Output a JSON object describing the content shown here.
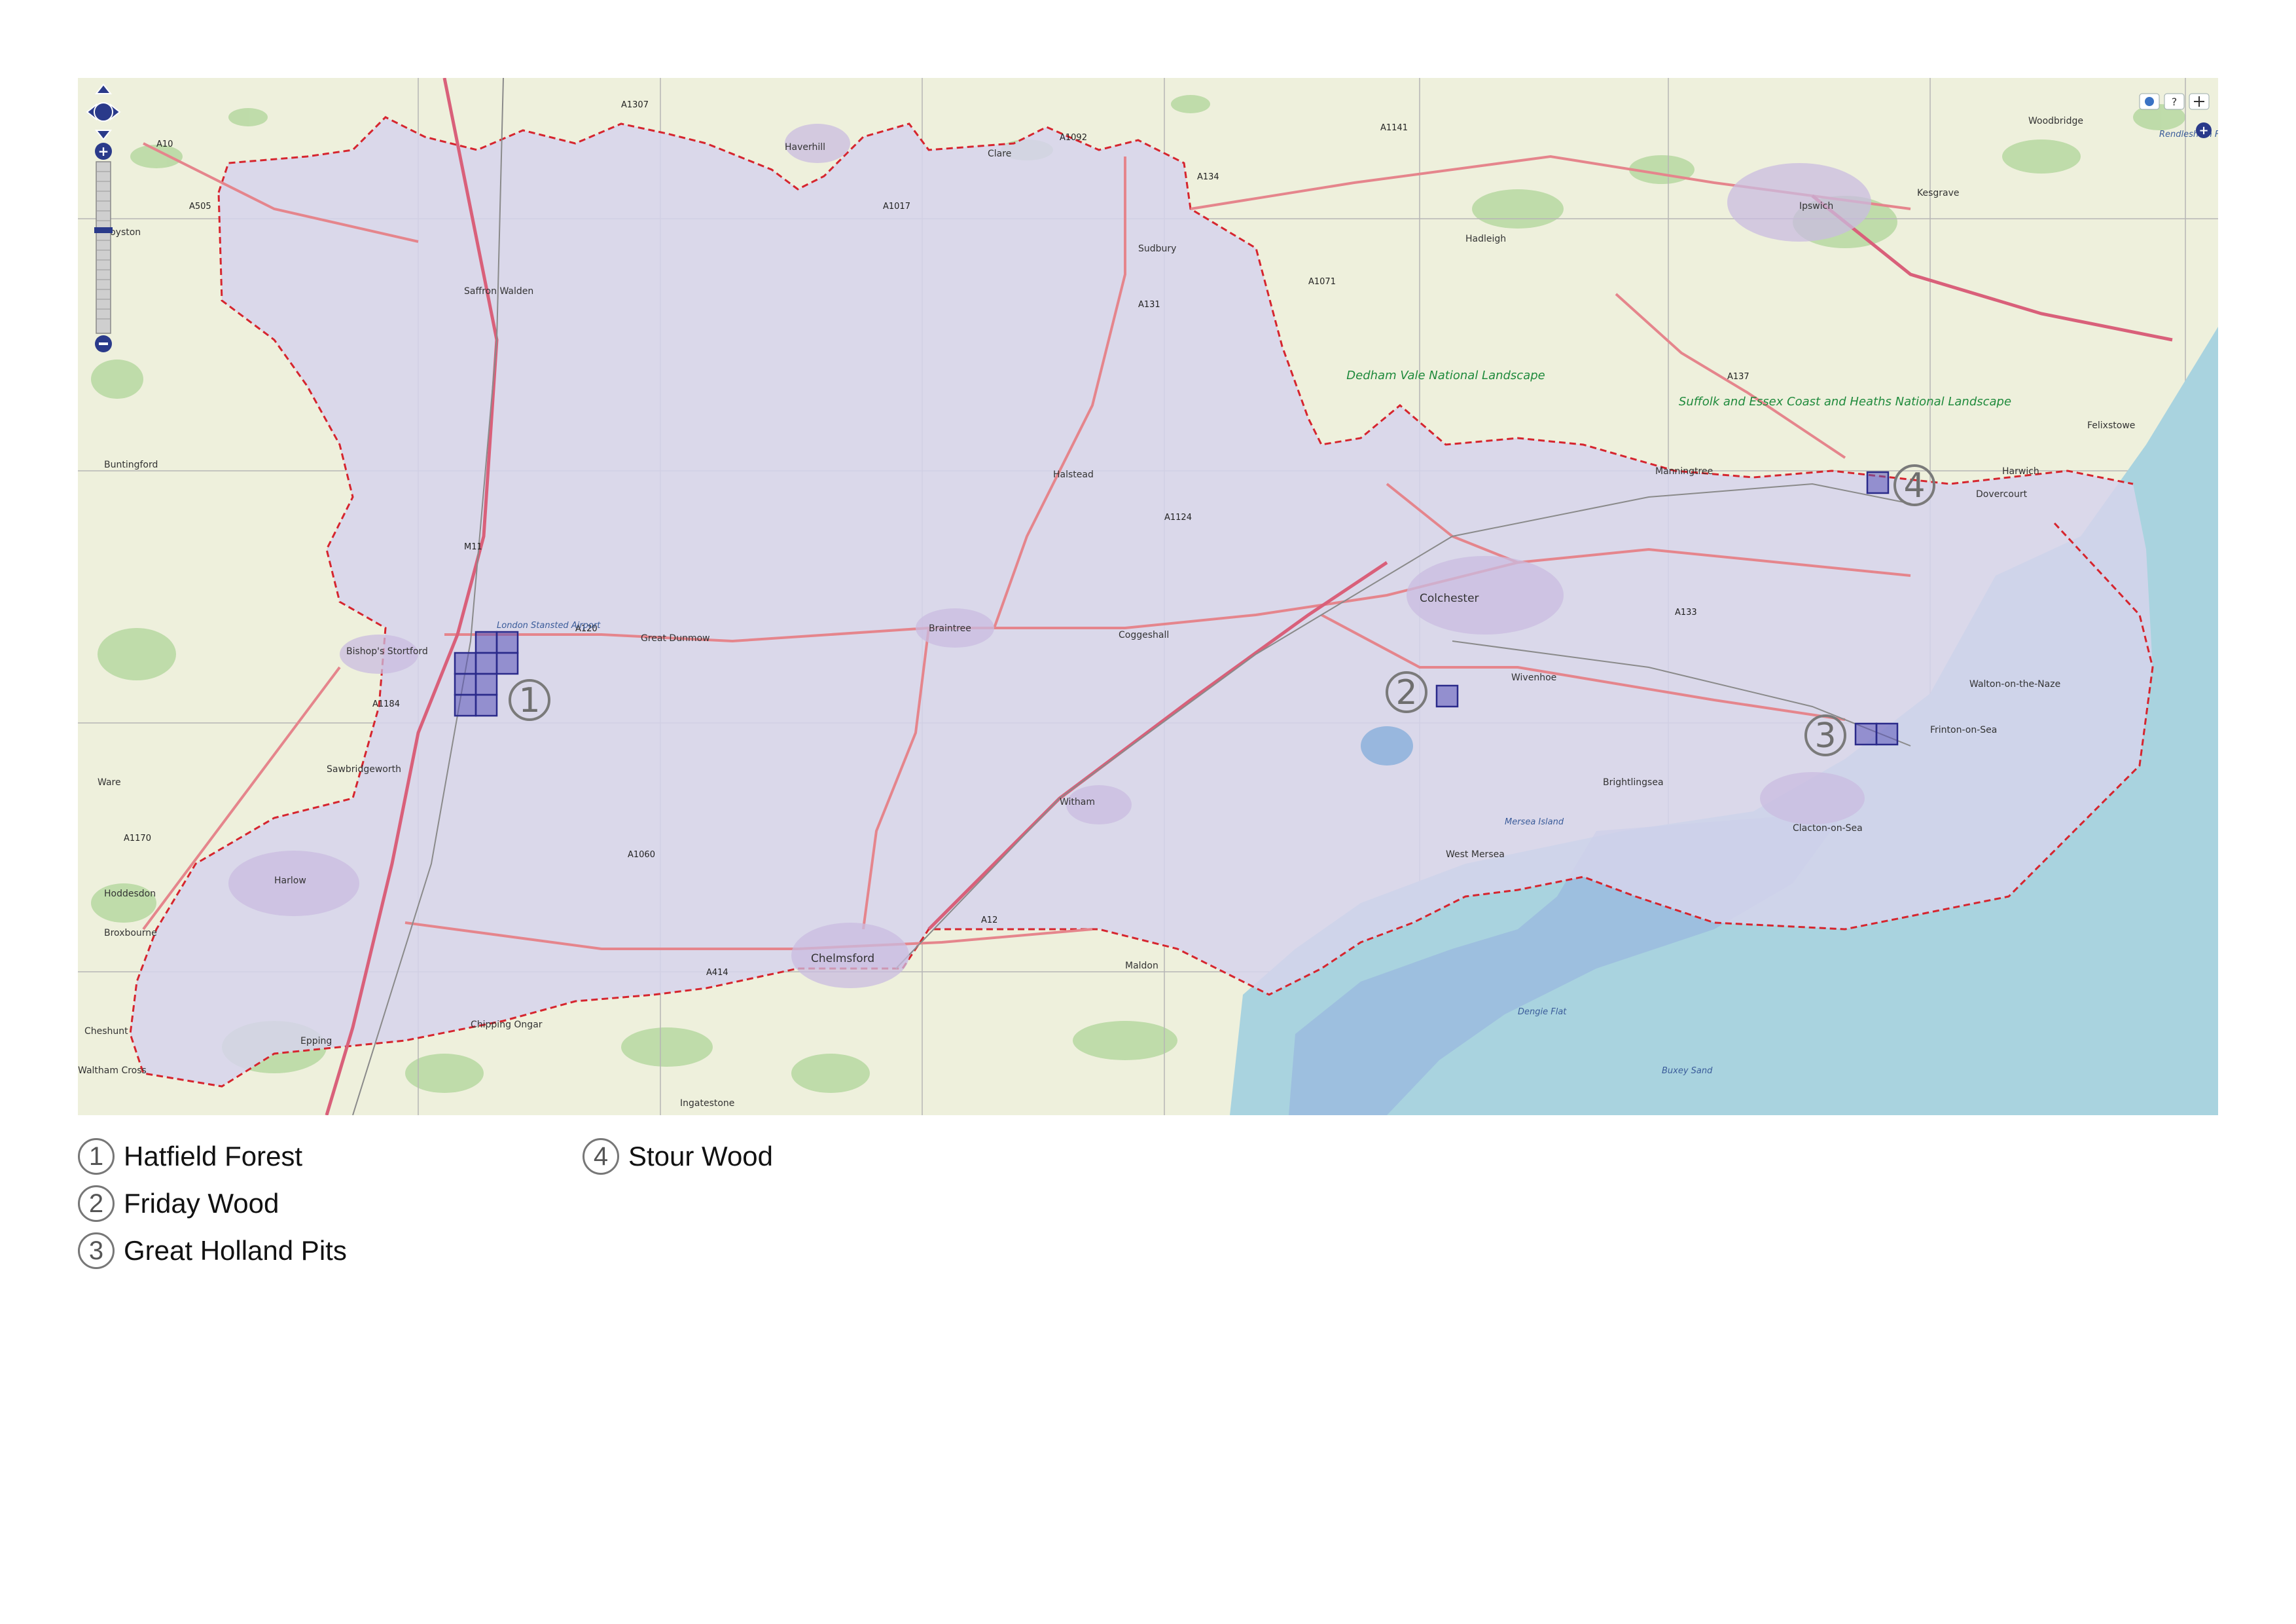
{
  "map": {
    "places": [
      "Royston",
      "Saffron Walden",
      "Haverhill",
      "Clare",
      "Sudbury",
      "Hadleigh",
      "Ipswich",
      "Woodbridge",
      "Kesgrave",
      "Buntingford",
      "Halstead",
      "Manningtree",
      "Harwich",
      "Dovercourt",
      "Felixstowe",
      "Bishop's Stortford",
      "Great Dunmow",
      "Braintree",
      "Coggeshall",
      "Colchester",
      "Wivenhoe",
      "Walton-on-the-Naze",
      "Frinton-on-Sea",
      "Clacton-on-Sea",
      "Brightlingsea",
      "West Mersea",
      "Sawbridgeworth",
      "Ware",
      "Harlow",
      "Hoddesdon",
      "Broxbourne",
      "Cheshunt",
      "Waltham Cross",
      "Epping",
      "Chipping Ongar",
      "Chelmsford",
      "Witham",
      "Maldon",
      "Ingatestone"
    ],
    "roads": [
      "A10",
      "A505",
      "A1307",
      "A1092",
      "A134",
      "A1141",
      "A1017",
      "A1071",
      "A131",
      "A137",
      "M11",
      "A1124",
      "A120",
      "A133",
      "A1184",
      "A1060",
      "A1170",
      "A414",
      "A12"
    ],
    "park_labels": {
      "dedham": "Dedham Vale National Landscape",
      "suffolk": "Suffolk and Essex Coast and Heaths National Landscape"
    },
    "water_labels": [
      "Mersea Island",
      "Dengie Flat",
      "Buxey Sand"
    ],
    "airport": "London Stansted Airport",
    "forest_label": "Rendlesham Forest",
    "markers": [
      "1",
      "2",
      "3",
      "4"
    ],
    "colors": {
      "land": "#eef0dc",
      "county_fill": "#d6d3ec",
      "boundary": "#d6252e",
      "sea": "#a9d3df",
      "estuary": "#98b7de",
      "site": "#5a54b8",
      "road": "#e5858c",
      "motorway": "#e892a2"
    }
  },
  "legend": [
    {
      "num": "1",
      "label": "Hatfield Forest"
    },
    {
      "num": "2",
      "label": "Friday Wood"
    },
    {
      "num": "3",
      "label": "Great Holland Pits"
    },
    {
      "num": "4",
      "label": "Stour Wood"
    }
  ]
}
